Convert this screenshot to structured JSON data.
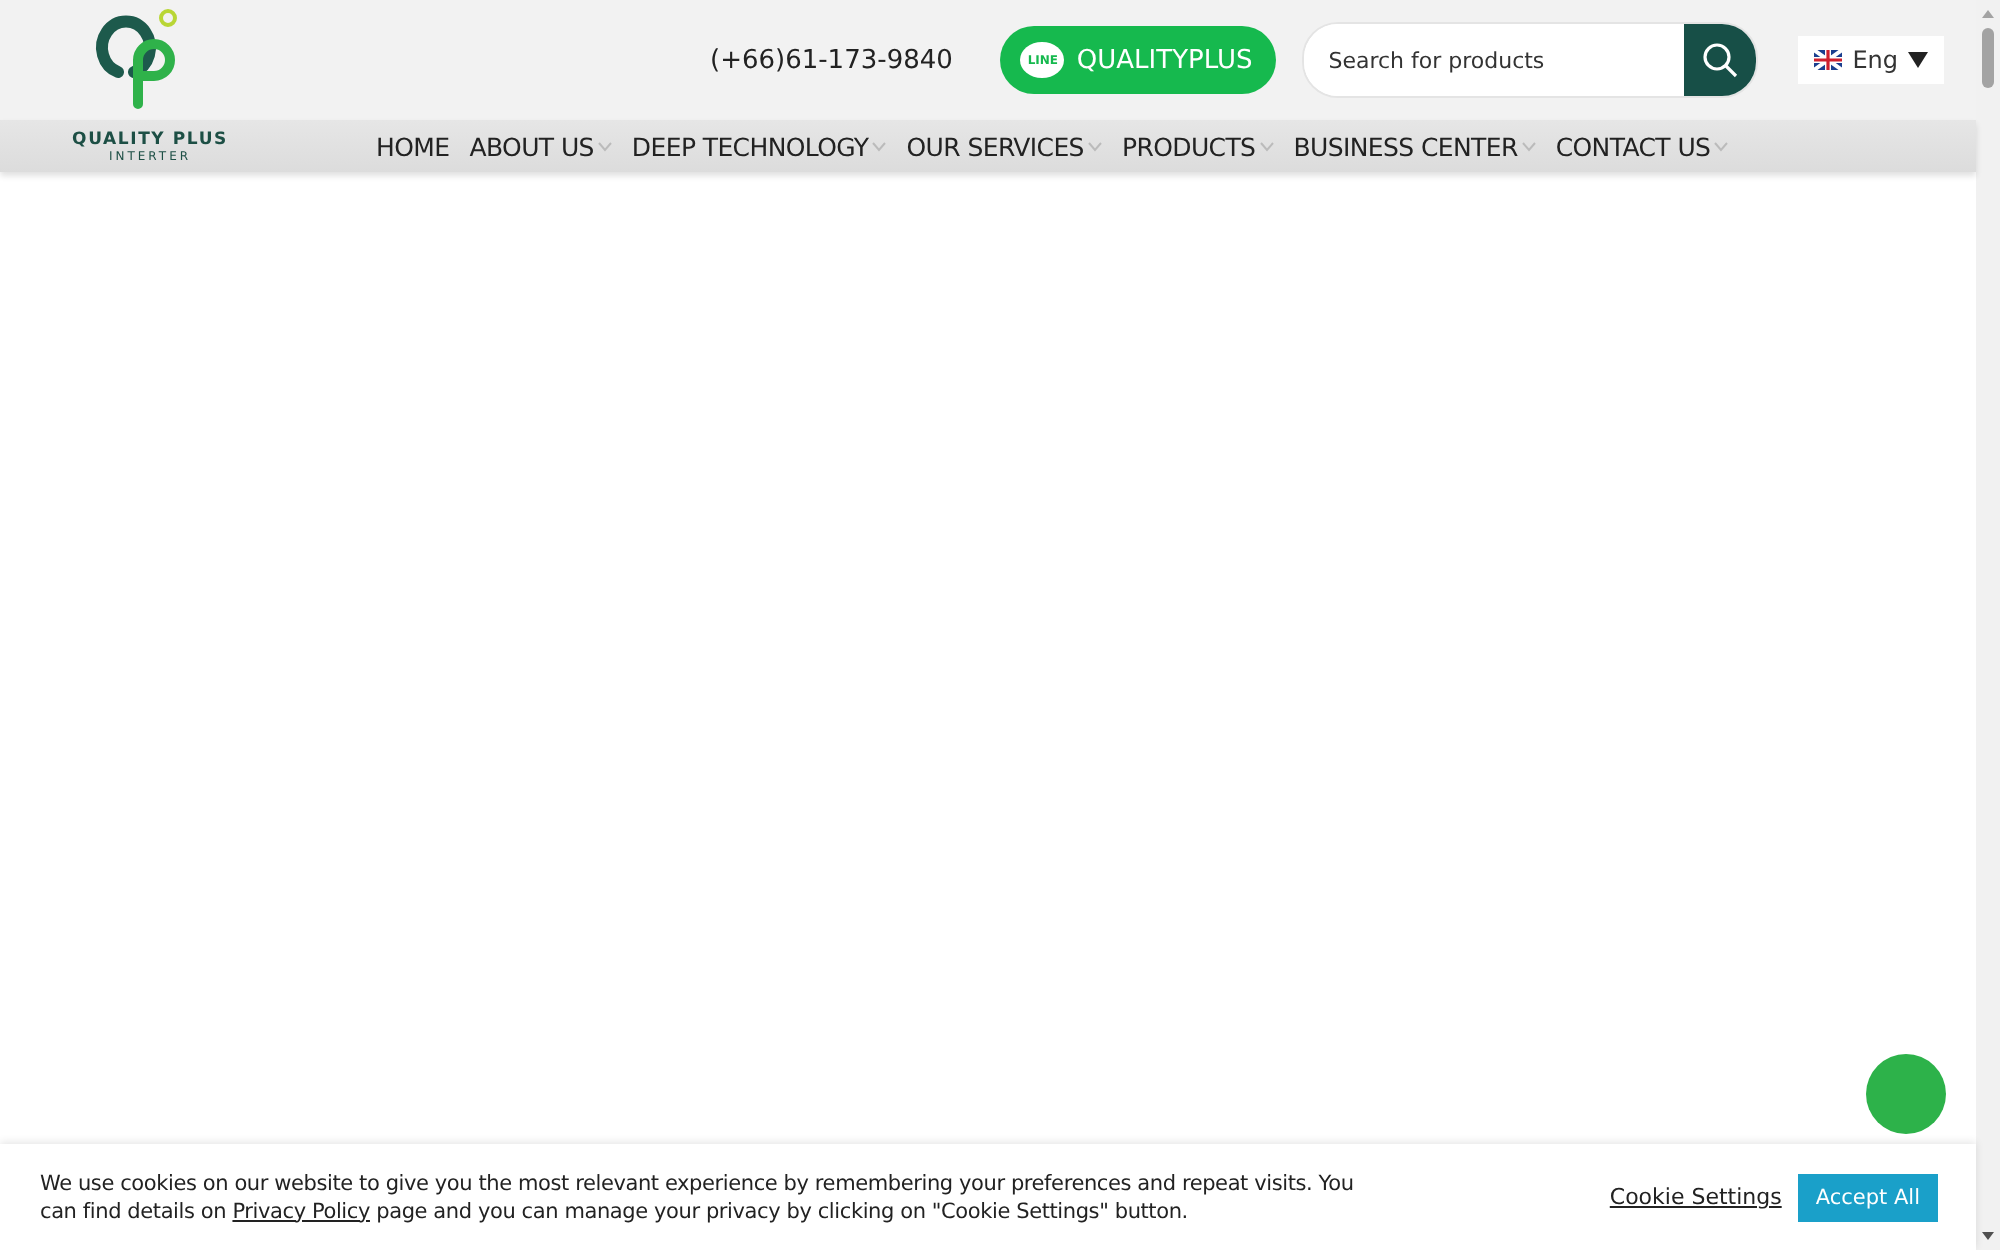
{
  "logo": {
    "name": "QUALITY PLUS",
    "tagline": "INTERTER"
  },
  "phone": "(+66)61-173-9840",
  "line_button": {
    "badge": "LINE",
    "label": "QUALITYPLUS"
  },
  "search": {
    "placeholder": "Search for products"
  },
  "language": {
    "label": "Eng"
  },
  "nav": [
    {
      "label": "HOME",
      "has_dropdown": false
    },
    {
      "label": "ABOUT US",
      "has_dropdown": true
    },
    {
      "label": "DEEP TECHNOLOGY",
      "has_dropdown": true
    },
    {
      "label": "OUR SERVICES",
      "has_dropdown": true
    },
    {
      "label": "PRODUCTS",
      "has_dropdown": true
    },
    {
      "label": "BUSINESS CENTER",
      "has_dropdown": true
    },
    {
      "label": "CONTACT US",
      "has_dropdown": true
    }
  ],
  "cookie_banner": {
    "text_before": "We use cookies on our website to give you the most relevant experience by remembering your preferences and repeat visits. You can find details on",
    "link": "Privacy Policy",
    "text_after": "page and you can manage your privacy by clicking on \"Cookie Settings\" button.",
    "settings_link": "Cookie Settings",
    "accept_button": "Accept All"
  }
}
